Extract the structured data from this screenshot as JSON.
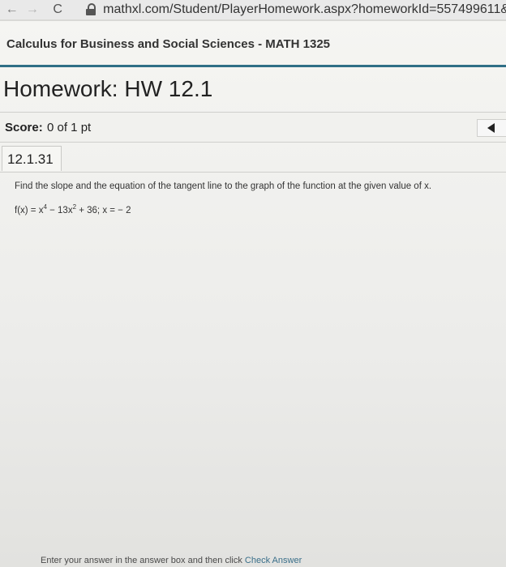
{
  "browser": {
    "url": "mathxl.com/Student/PlayerHomework.aspx?homeworkId=557499611&qu",
    "back_icon": "←",
    "forward_icon": "→",
    "reload_icon": "C"
  },
  "course": {
    "title": "Calculus for Business and Social Sciences - MATH 1325"
  },
  "homework": {
    "title": "Homework: HW 12.1"
  },
  "score": {
    "label": "Score:",
    "value": "0 of 1 pt"
  },
  "problem": {
    "id": "12.1.31",
    "instruction": "Find the slope and the equation of the tangent line to the graph of the function at the given value of x.",
    "function_prefix": "f(x) = x",
    "exp1": "4",
    "function_mid": " − 13x",
    "exp2": "2",
    "function_suffix": " + 36; x = − 2"
  },
  "footer": {
    "text_start": "Enter your answer in the answer box and then click ",
    "link_text": "Check Answer"
  },
  "colors": {
    "accent_rule": "#2f6f86",
    "link": "#3a6f8a"
  }
}
